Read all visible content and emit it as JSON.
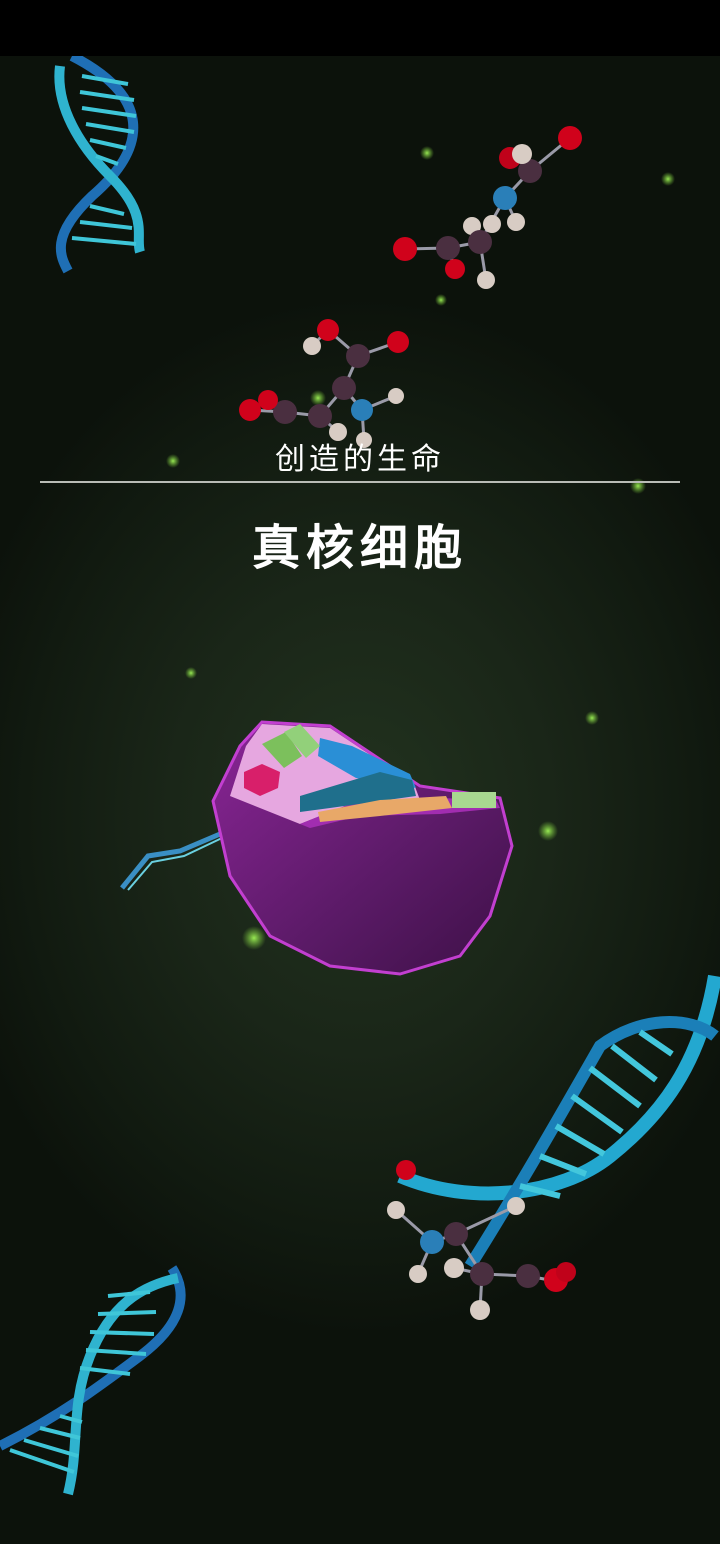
{
  "header": {
    "subtitle": "创造的生命",
    "title": "真核细胞"
  },
  "colors": {
    "background": "#131c12",
    "dna": "#29a7c4",
    "cell_membrane": "#7a1f86",
    "atom_oxygen": "#d0021b",
    "atom_nitrogen": "#2a7fb8",
    "atom_carbon": "#4a2f40",
    "atom_hydrogen": "#d8ccc4",
    "particle": "#7fd13b"
  },
  "icons": [
    "dna-helix-icon",
    "molecule-icon",
    "eukaryotic-cell-icon"
  ]
}
